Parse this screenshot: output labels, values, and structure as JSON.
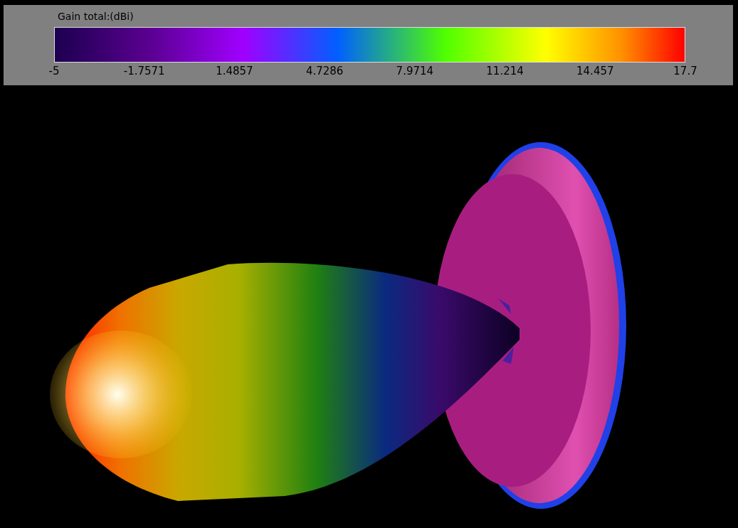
{
  "legend": {
    "title": "Gain total:(dBi)",
    "ticks": [
      "-5",
      "-1.7571",
      "1.4857",
      "4.7286",
      "7.9714",
      "11.214",
      "14.457",
      "17.7"
    ]
  }
}
